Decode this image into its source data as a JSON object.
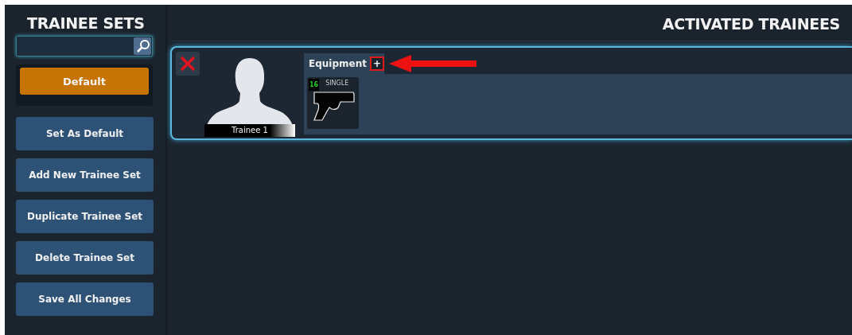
{
  "sidebar": {
    "title": "TRAINEE SETS",
    "sets": [
      {
        "label": "Default",
        "selected": true
      }
    ],
    "actions": [
      "Set As Default",
      "Add New Trainee Set",
      "Duplicate Trainee Set",
      "Delete Trainee Set",
      "Save All Changes"
    ]
  },
  "main": {
    "title": "ACTIVATED TRAINEES",
    "trainees": [
      {
        "name": "Trainee 1",
        "tab": "Equipment",
        "add": "+",
        "equipment": [
          {
            "count": "16",
            "mode": "SINGLE"
          }
        ]
      }
    ]
  }
}
